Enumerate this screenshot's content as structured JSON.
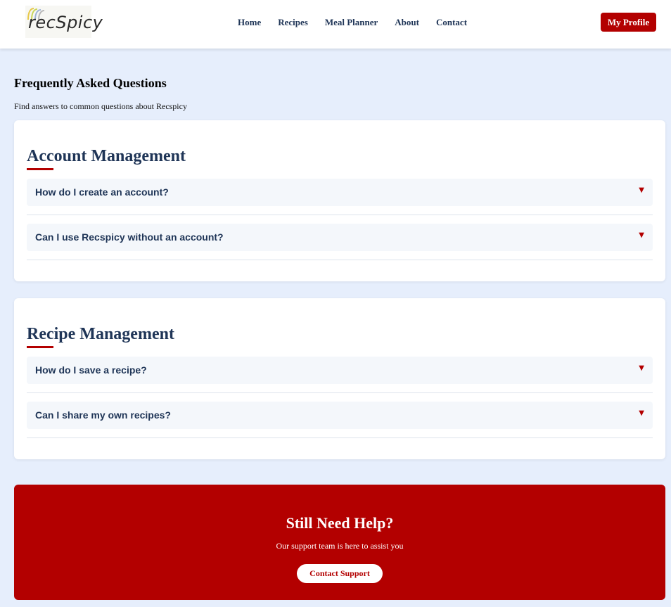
{
  "brand": {
    "logo_text": "recSpicy"
  },
  "nav": {
    "items": [
      "Home",
      "Recipes",
      "Meal Planner",
      "About",
      "Contact"
    ],
    "profile_label": "My Profile"
  },
  "intro": {
    "title": "Frequently Asked Questions",
    "subtitle": "Find answers to common questions about Recspicy"
  },
  "sections": [
    {
      "title": "Account Management",
      "questions": [
        "How do I create an account?",
        "Can I use Recspicy without an account?"
      ]
    },
    {
      "title": "Recipe Management",
      "questions": [
        "How do I save a recipe?",
        "Can I share my own recipes?"
      ]
    }
  ],
  "help": {
    "title": "Still Need Help?",
    "subtitle": "Our support team is here to assist you",
    "button_label": "Contact Support"
  },
  "icons": {
    "expand": "caret-down-icon"
  },
  "colors": {
    "accent": "#b30000",
    "navy": "#1f3557",
    "background": "#e6eefc"
  }
}
